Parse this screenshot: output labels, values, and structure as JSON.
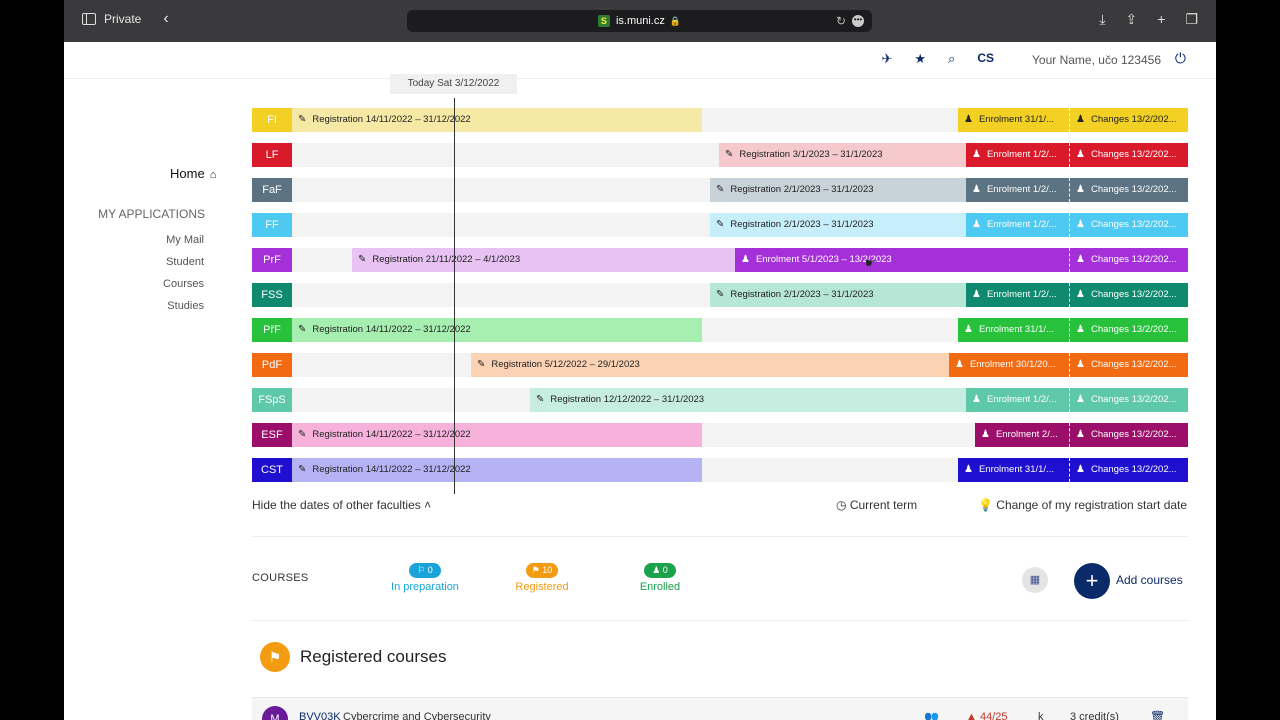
{
  "browser": {
    "mode_label": "Private",
    "url": "is.muni.cz",
    "site_icon_glyph": "S"
  },
  "header": {
    "lang": "CS",
    "user": "Your Name, učo 123456"
  },
  "nav": {
    "home": "Home",
    "section": "MY APPLICATIONS",
    "items": [
      "My Mail",
      "Student",
      "Courses",
      "Studies"
    ]
  },
  "timeline": {
    "today_label": "Today Sat 3/12/2022",
    "rows": [
      {
        "code": "FI",
        "color": "#f2d024",
        "reg": {
          "label": "Registration 14/11/2022 – 31/12/2022",
          "bg": "#f6e9a6"
        },
        "enr": {
          "label": "Enrolment 31/1/...",
          "bg": "#f2d024"
        },
        "chg": {
          "label": "Changes 13/2/202...",
          "bg": "#f2d024"
        }
      },
      {
        "code": "LF",
        "color": "#d91a2a",
        "reg": {
          "label": "Registration 3/1/2023 – 31/1/2023",
          "bg": "#f6c9cc"
        },
        "enr": {
          "label": "Enrolment 1/2/...",
          "bg": "#d91a2a"
        },
        "chg": {
          "label": "Changes 13/2/202...",
          "bg": "#d91a2a"
        }
      },
      {
        "code": "FaF",
        "color": "#5c7383",
        "reg": {
          "label": "Registration 2/1/2023 – 31/1/2023",
          "bg": "#c8d3d9"
        },
        "enr": {
          "label": "Enrolment 1/2/...",
          "bg": "#5c7383"
        },
        "chg": {
          "label": "Changes 13/2/202...",
          "bg": "#5c7383"
        }
      },
      {
        "code": "FF",
        "color": "#4ec9f2",
        "reg": {
          "label": "Registration 2/1/2023 – 31/1/2023",
          "bg": "#c7eefb"
        },
        "enr": {
          "label": "Enrolment 1/2/...",
          "bg": "#4ec9f2"
        },
        "chg": {
          "label": "Changes 13/2/202...",
          "bg": "#4ec9f2"
        }
      },
      {
        "code": "PrF",
        "color": "#a52fd8",
        "reg": {
          "label": "Registration 21/11/2022 – 4/1/2023",
          "bg": "#e7c2f3"
        },
        "enr": {
          "label": "Enrolment 5/1/2023 – 13/2/2023",
          "bg": "#a52fd8"
        },
        "chg": {
          "label": "Changes 13/2/202...",
          "bg": "#a52fd8"
        }
      },
      {
        "code": "FSS",
        "color": "#0f8a6e",
        "reg": {
          "label": "Registration 2/1/2023 – 31/1/2023",
          "bg": "#b6e6d6"
        },
        "enr": {
          "label": "Enrolment 1/2/...",
          "bg": "#0f8a6e"
        },
        "chg": {
          "label": "Changes 13/2/202...",
          "bg": "#0f8a6e"
        }
      },
      {
        "code": "PřF",
        "color": "#27c13b",
        "reg": {
          "label": "Registration 14/11/2022 – 31/12/2022",
          "bg": "#a7efb0"
        },
        "enr": {
          "label": "Enrolment 31/1/...",
          "bg": "#27c13b"
        },
        "chg": {
          "label": "Changes 13/2/202...",
          "bg": "#27c13b"
        }
      },
      {
        "code": "PdF",
        "color": "#f26a12",
        "reg": {
          "label": "Registration 5/12/2022 – 29/1/2023",
          "bg": "#fbd3b4"
        },
        "enr": {
          "label": "Enrolment 30/1/20...",
          "bg": "#f26a12"
        },
        "chg": {
          "label": "Changes 13/2/202...",
          "bg": "#f26a12"
        }
      },
      {
        "code": "FSpS",
        "color": "#5ec9a8",
        "reg": {
          "label": "Registration 12/12/2022 – 31/1/2023",
          "bg": "#c6ede0"
        },
        "enr": {
          "label": "Enrolment 1/2/...",
          "bg": "#5ec9a8"
        },
        "chg": {
          "label": "Changes 13/2/202...",
          "bg": "#5ec9a8"
        }
      },
      {
        "code": "ESF",
        "color": "#9b0f6a",
        "reg": {
          "label": "Registration 14/11/2022 – 31/12/2022",
          "bg": "#f7b2dc"
        },
        "enr": {
          "label": "Enrolment 2/...",
          "bg": "#9b0f6a"
        },
        "chg": {
          "label": "Changes 13/2/202...",
          "bg": "#9b0f6a"
        }
      },
      {
        "code": "CST",
        "color": "#1f0fd0",
        "reg": {
          "label": "Registration 14/11/2022 – 31/12/2022",
          "bg": "#b6b3f5"
        },
        "enr": {
          "label": "Enrolment 31/1/...",
          "bg": "#1f0fd0"
        },
        "chg": {
          "label": "Changes 13/2/202...",
          "bg": "#1f0fd0"
        }
      }
    ],
    "hide_label": "Hide the dates of other faculties",
    "current_term": "Current term",
    "change_start": "Change of my registration start date"
  },
  "courses": {
    "label": "COURSES",
    "stats": [
      {
        "count": "0",
        "label": "In preparation",
        "color": "#1aa3d9"
      },
      {
        "count": "10",
        "label": "Registered",
        "color": "#f39c12"
      },
      {
        "count": "0",
        "label": "Enrolled",
        "color": "#1aa34a"
      }
    ],
    "add_label": "Add courses",
    "registered_title": "Registered courses",
    "first_course": {
      "code": "BVV03K",
      "name": "Cybercrime and Cybersecurity",
      "capacity": "44/25",
      "completion": "k",
      "credits": "3 credit(s)"
    }
  }
}
